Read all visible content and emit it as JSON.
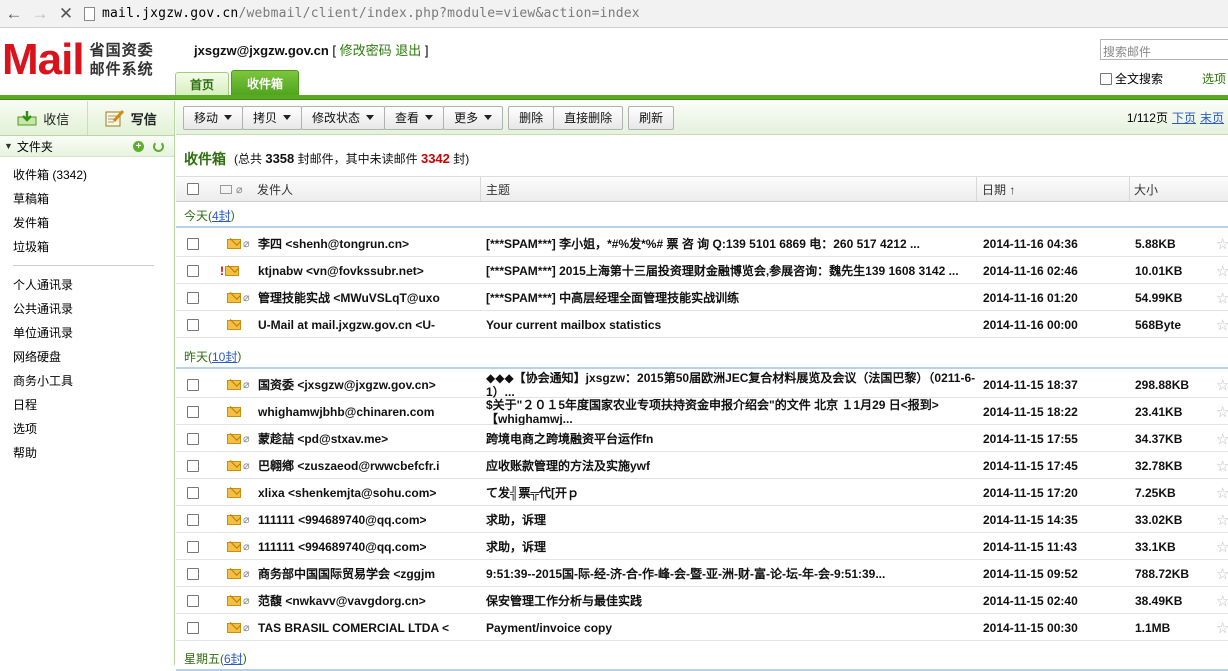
{
  "browser": {
    "back": "←",
    "forward": "→",
    "stop": "✕",
    "url_domain": "mail.jxgzw.gov.cn",
    "url_rest": "/webmail/client/index.php?module=view&action=index"
  },
  "brand": {
    "logo_text": "Mail",
    "logo_sub_line1": "省国资委",
    "logo_sub_line2": "邮件系统",
    "accent_color": "#58aa22",
    "logo_color": "#d9121b"
  },
  "user": {
    "email": "jxsgzw@jxgzw.gov.cn",
    "bracket_open": "[",
    "change_password": "修改密码",
    "logout": "退出",
    "bracket_close": "]"
  },
  "tabs": [
    {
      "label": "首页"
    },
    {
      "label": "收件箱"
    }
  ],
  "search": {
    "placeholder": "搜索邮件",
    "fulltext_label": "全文搜索",
    "options": "选项"
  },
  "sidebar": {
    "receive": "收信",
    "write": "写信",
    "folders_title": "文件夹",
    "folders": [
      {
        "label": "收件箱 (3342)"
      },
      {
        "label": "草稿箱"
      },
      {
        "label": "发件箱"
      },
      {
        "label": "垃圾箱"
      }
    ],
    "tools": [
      {
        "label": "个人通讯录"
      },
      {
        "label": "公共通讯录"
      },
      {
        "label": "单位通讯录"
      },
      {
        "label": "网络硬盘"
      },
      {
        "label": "商务小工具"
      },
      {
        "label": "日程"
      },
      {
        "label": "选项"
      },
      {
        "label": "帮助"
      }
    ]
  },
  "toolbar": {
    "move": "移动",
    "copy": "拷贝",
    "mark": "修改状态",
    "view": "查看",
    "more": "更多",
    "delete": "删除",
    "delete_direct": "直接删除",
    "refresh": "刷新",
    "page": "1/112页",
    "next": "下页",
    "last": "末页"
  },
  "inbox": {
    "title": "收件箱",
    "summary_pre": "(总共",
    "total": "3358",
    "summary_mid": "封邮件，其中未读邮件",
    "unread": "3342",
    "summary_post": "封)"
  },
  "columns": {
    "from": "发件人",
    "subject": "主题",
    "date": "日期 ↑",
    "size": "大小"
  },
  "groups": [
    {
      "label": "今天(",
      "count": "4封",
      "close": ")"
    },
    {
      "label": "昨天(",
      "count": "10封",
      "close": ")"
    },
    {
      "label": "星期五(",
      "count": "6封",
      "close": ")"
    }
  ],
  "emails": [
    {
      "from": "李四 <shenh@tongrun.cn>",
      "subject": "[***SPAM***] 李小姐，*#%发*%# 票 咨 询 Q:139 5101 6869 电：260 517 4212 ...",
      "date": "2014-11-16 04:36",
      "size": "5.88KB",
      "attach": true,
      "important": false
    },
    {
      "from": "ktjnabw <vn@fovkssubr.net>",
      "subject": "[***SPAM***] 2015上海第十三届投资理财金融博览会,参展咨询：魏先生139 1608 3142 ...",
      "date": "2014-11-16 02:46",
      "size": "10.01KB",
      "attach": false,
      "important": true
    },
    {
      "from": "管理技能实战 <MWuVSLqT@uxo",
      "subject": "[***SPAM***] 中高层经理全面管理技能实战训练",
      "date": "2014-11-16 01:20",
      "size": "54.99KB",
      "attach": true,
      "important": false
    },
    {
      "from": "U-Mail at mail.jxgzw.gov.cn <U-",
      "subject": "Your current mailbox statistics",
      "date": "2014-11-16 00:00",
      "size": "568Byte",
      "attach": false,
      "important": false
    },
    {
      "from": "国资委 <jxsgzw@jxgzw.gov.cn>",
      "subject": "◆◆◆【协会通知】jxsgzw：2015第50届欧洲JEC复合材料展览及会议（法国巴黎）（0211-6-1）...",
      "date": "2014-11-15 18:37",
      "size": "298.88KB",
      "attach": true,
      "important": false
    },
    {
      "from": "whighamwjbhb@chinaren.com",
      "subject": "$关于\"２０１5年度国家农业专项扶持资金申报介绍会\"的文件 北京 １1月29 日<报到> 【whighamwj...",
      "date": "2014-11-15 18:22",
      "size": "23.41KB",
      "attach": false,
      "important": false
    },
    {
      "from": "蒙趁喆 <pd@stxav.me>",
      "subject": "跨境电商之跨境融资平台运作fn",
      "date": "2014-11-15 17:55",
      "size": "34.37KB",
      "attach": true,
      "important": false
    },
    {
      "from": "巴翱鄕 <zuszaeod@rwwcbefcfr.i",
      "subject": "应收账款管理的方法及实施ywf",
      "date": "2014-11-15 17:45",
      "size": "32.78KB",
      "attach": true,
      "important": false
    },
    {
      "from": "xlixa <shenkemjta@sohu.com>",
      "subject": "て发╣票╦代[开ｐ",
      "date": "2014-11-15 17:20",
      "size": "7.25KB",
      "attach": false,
      "important": false
    },
    {
      "from": "111111 <994689740@qq.com>",
      "subject": "求助，诉理",
      "date": "2014-11-15 14:35",
      "size": "33.02KB",
      "attach": true,
      "important": false
    },
    {
      "from": "111111 <994689740@qq.com>",
      "subject": "求助，诉理",
      "date": "2014-11-15 11:43",
      "size": "33.1KB",
      "attach": true,
      "important": false
    },
    {
      "from": "商务部中国国际贸易学会 <zggjm",
      "subject": "9:51:39--2015国-际-经-济-合-作-峰-会-暨-亚-洲-财-富-论-坛-年-会-9:51:39...",
      "date": "2014-11-15 09:52",
      "size": "788.72KB",
      "attach": true,
      "important": false
    },
    {
      "from": "范馥 <nwkavv@vavgdorg.cn>",
      "subject": "保安管理工作分析与最佳实践",
      "date": "2014-11-15 02:40",
      "size": "38.49KB",
      "attach": true,
      "important": false
    },
    {
      "from": "TAS BRASIL COMERCIAL LTDA <",
      "subject": "Payment/invoice copy",
      "date": "2014-11-15 00:30",
      "size": "1.1MB",
      "attach": true,
      "important": false
    }
  ]
}
